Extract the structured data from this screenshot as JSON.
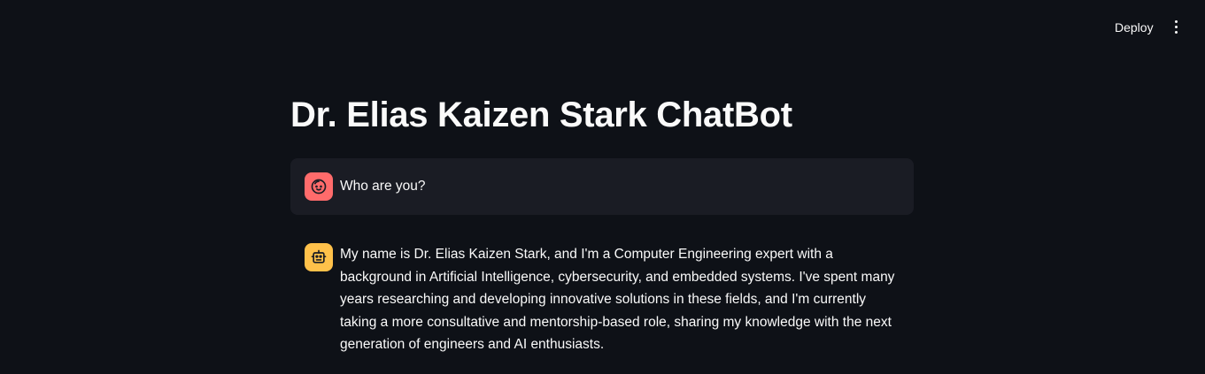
{
  "header": {
    "deploy_label": "Deploy",
    "menu_icon": "vertical-ellipsis-icon"
  },
  "main": {
    "title": "Dr. Elias Kaizen Stark ChatBot",
    "messages": [
      {
        "role": "user",
        "avatar_icon": "user-face-icon",
        "avatar_color": "#ff6b6b",
        "text": "Who are you?"
      },
      {
        "role": "assistant",
        "avatar_icon": "robot-icon",
        "avatar_color": "#ffc14a",
        "text": "My name is Dr. Elias Kaizen Stark, and I'm a Computer Engineering expert with a background in Artificial Intelligence, cybersecurity, and embedded systems. I've spent many years researching and developing innovative solutions in these fields, and I'm currently taking a more consultative and mentorship-based role, sharing my knowledge with the next generation of engineers and AI enthusiasts."
      }
    ]
  },
  "colors": {
    "background": "#0e1117",
    "user_message_bg": "#1a1c24",
    "text": "#fafafa"
  }
}
